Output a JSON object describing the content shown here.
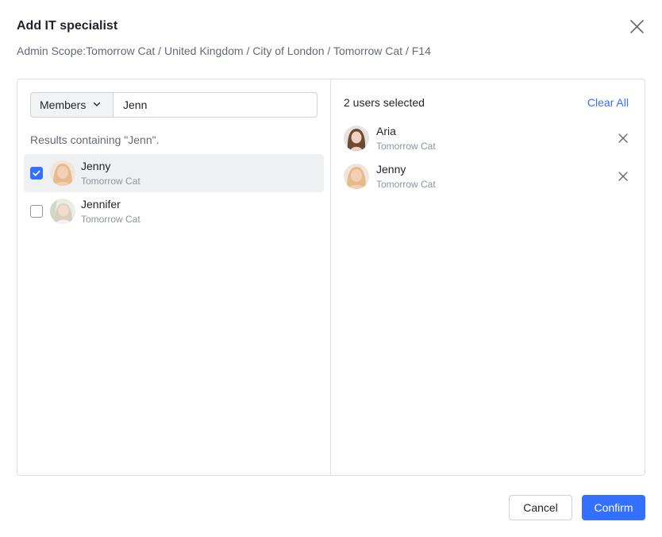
{
  "dialog": {
    "title": "Add IT specialist",
    "subtitle": "Admin Scope:Tomorrow Cat / United Kingdom / City of London / Tomorrow Cat / F14"
  },
  "search": {
    "scope_label": "Members",
    "query": "Jenn",
    "results_hint": "Results containing \"Jenn\"."
  },
  "results": [
    {
      "name": "Jenny",
      "org": "Tomorrow Cat",
      "checked": true
    },
    {
      "name": "Jennifer",
      "org": "Tomorrow Cat",
      "checked": false
    }
  ],
  "selection": {
    "count_label": "2 users selected",
    "clear_label": "Clear All",
    "items": [
      {
        "name": "Aria",
        "org": "Tomorrow Cat"
      },
      {
        "name": "Jenny",
        "org": "Tomorrow Cat"
      }
    ]
  },
  "footer": {
    "cancel_label": "Cancel",
    "confirm_label": "Confirm"
  },
  "colors": {
    "accent": "#3370ff",
    "selected_row": "#eff0f1",
    "border": "#dee0e3"
  },
  "icons": {
    "close": "close-icon",
    "chevron": "chevron-down-icon",
    "check": "check-icon",
    "remove": "remove-icon"
  }
}
